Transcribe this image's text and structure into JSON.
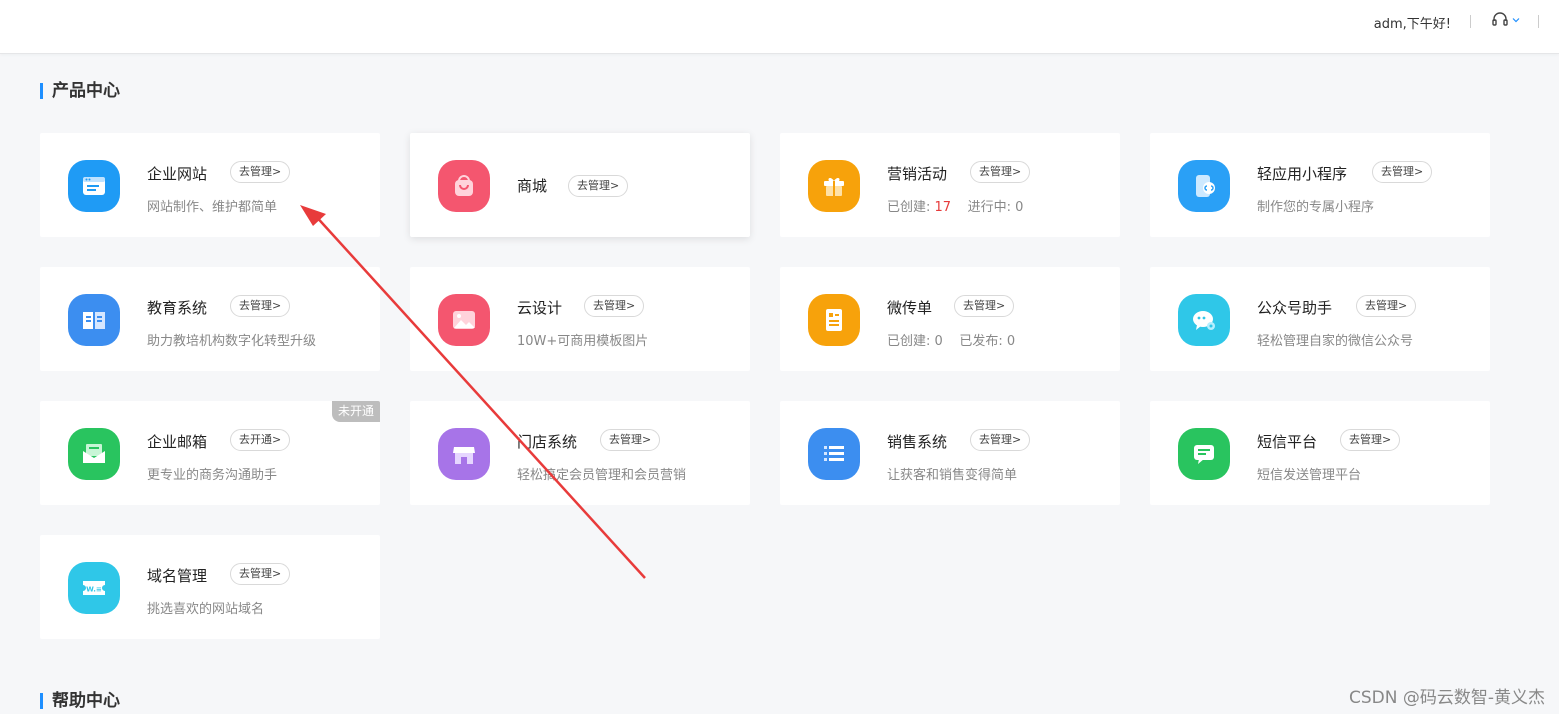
{
  "header": {
    "greeting": "adm,下午好!",
    "support_icon": "headset-icon",
    "dropdown_icon": "chevron-down-icon"
  },
  "sections": {
    "product_center": "产品中心",
    "help_center": "帮助中心"
  },
  "colors": {
    "accent": "#1e8fff",
    "stat_highlight": "#e63b3b",
    "arrow": "#e83b3b"
  },
  "cards": [
    {
      "name": "企业网站",
      "action": "去管理>",
      "desc": "网站制作、维护都简单",
      "icon": "website-icon",
      "color": "#1f9bf5"
    },
    {
      "name": "商城",
      "action": "去管理>",
      "desc": "",
      "icon": "shopping-bag-icon",
      "color": "#f4566f"
    },
    {
      "name": "营销活动",
      "action": "去管理>",
      "stat1_label": "已创建:",
      "stat1_value": "17",
      "stat2_label": "进行中:",
      "stat2_value": "0",
      "icon": "gift-icon",
      "color": "#f7a20b"
    },
    {
      "name": "轻应用小程序",
      "action": "去管理>",
      "desc": "制作您的专属小程序",
      "icon": "miniprogram-icon",
      "color": "#2aa0f6"
    },
    {
      "name": "教育系统",
      "action": "去管理>",
      "desc": "助力教培机构数字化转型升级",
      "icon": "book-icon",
      "color": "#3c8ef0"
    },
    {
      "name": "云设计",
      "action": "去管理>",
      "desc": "10W+可商用模板图片",
      "icon": "image-icon",
      "color": "#f4566f"
    },
    {
      "name": "微传单",
      "action": "去管理>",
      "stat1_label": "已创建:",
      "stat1_value": "0",
      "stat2_label": "已发布:",
      "stat2_value": "0",
      "icon": "flyer-icon",
      "color": "#f7a20b"
    },
    {
      "name": "公众号助手",
      "action": "去管理>",
      "desc": "轻松管理自家的微信公众号",
      "icon": "wechat-icon",
      "color": "#2fc7e8"
    },
    {
      "name": "企业邮箱",
      "action": "去开通>",
      "desc": "更专业的商务沟通助手",
      "tag": "未开通",
      "icon": "mail-icon",
      "color": "#29c45f"
    },
    {
      "name": "门店系统",
      "action": "去管理>",
      "desc": "轻松搞定会员管理和会员营销",
      "icon": "store-icon",
      "color": "#a774e8"
    },
    {
      "name": "销售系统",
      "action": "去管理>",
      "desc": "让获客和销售变得简单",
      "icon": "list-icon",
      "color": "#3c8ef0"
    },
    {
      "name": "短信平台",
      "action": "去管理>",
      "desc": "短信发送管理平台",
      "icon": "sms-icon",
      "color": "#29c45f"
    },
    {
      "name": "域名管理",
      "action": "去管理>",
      "desc": "挑选喜欢的网站域名",
      "icon": "domain-icon",
      "color": "#2fc7e8"
    }
  ],
  "watermark": "CSDN @码云数智-黄义杰"
}
